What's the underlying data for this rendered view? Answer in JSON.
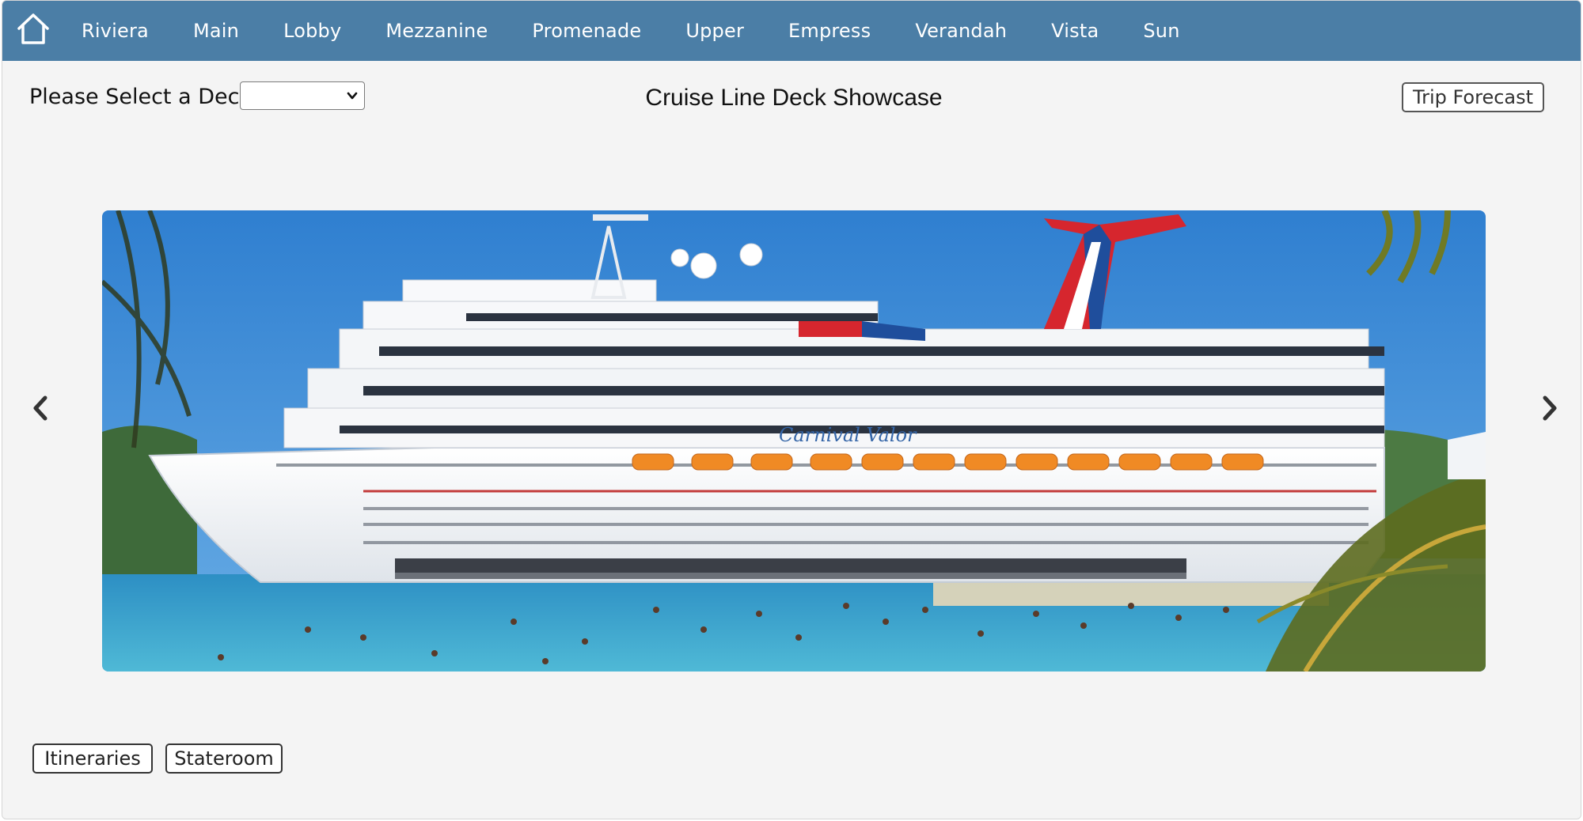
{
  "nav": {
    "home_icon": "home-icon",
    "items": [
      "Riviera",
      "Main",
      "Lobby",
      "Mezzanine",
      "Promenade",
      "Upper",
      "Empress",
      "Verandah",
      "Vista",
      "Sun"
    ]
  },
  "deck_selector": {
    "label": "Please Select a Deck",
    "selected": ""
  },
  "title": "Cruise Line Deck Showcase",
  "buttons": {
    "trip_forecast": "Trip Forecast",
    "itineraries": "Itineraries",
    "stateroom": "Stateroom"
  },
  "carousel": {
    "prev_icon": "chevron-left-icon",
    "next_icon": "chevron-right-icon",
    "image": {
      "ship_name": "Carnival Valor"
    }
  },
  "colors": {
    "nav_bg": "#4b7ea6",
    "page_bg": "#f4f4f4",
    "funnel_red": "#d6262e",
    "funnel_blue": "#1f4e9c"
  }
}
